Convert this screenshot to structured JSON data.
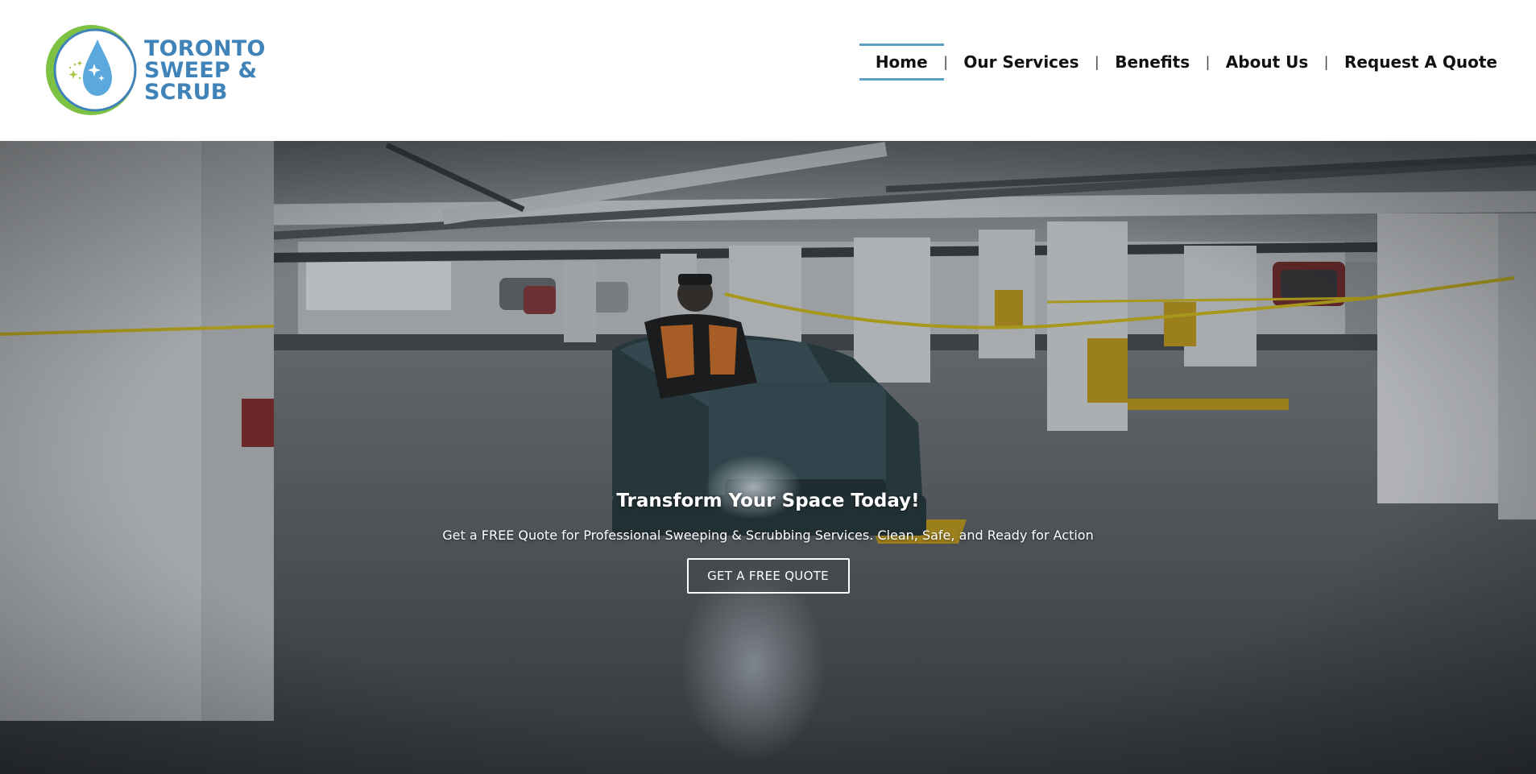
{
  "brand": {
    "name_lines": [
      "TORONTO",
      "SWEEP &",
      "SCRUB"
    ],
    "colors": {
      "brand_blue": "#3f83b8",
      "drop_blue": "#5aa8de",
      "ring_green": "#7dc242",
      "sparkle": "#a9c94a",
      "nav_active_underline": "#5b9fc4"
    }
  },
  "nav": {
    "items": [
      {
        "label": "Home",
        "active": true
      },
      {
        "label": "Our Services",
        "active": false
      },
      {
        "label": "Benefits",
        "active": false
      },
      {
        "label": "About Us",
        "active": false
      },
      {
        "label": "Request A Quote",
        "active": false
      }
    ],
    "separator": "|"
  },
  "hero": {
    "title": "Transform Your Space Today!",
    "subtitle": "Get a FREE Quote for Professional Sweeping & Scrubbing Services. Clean, Safe, and Ready for Action",
    "cta_label": "GET A FREE QUOTE",
    "background_scene": "underground-parking-garage-floor-scrubber"
  }
}
